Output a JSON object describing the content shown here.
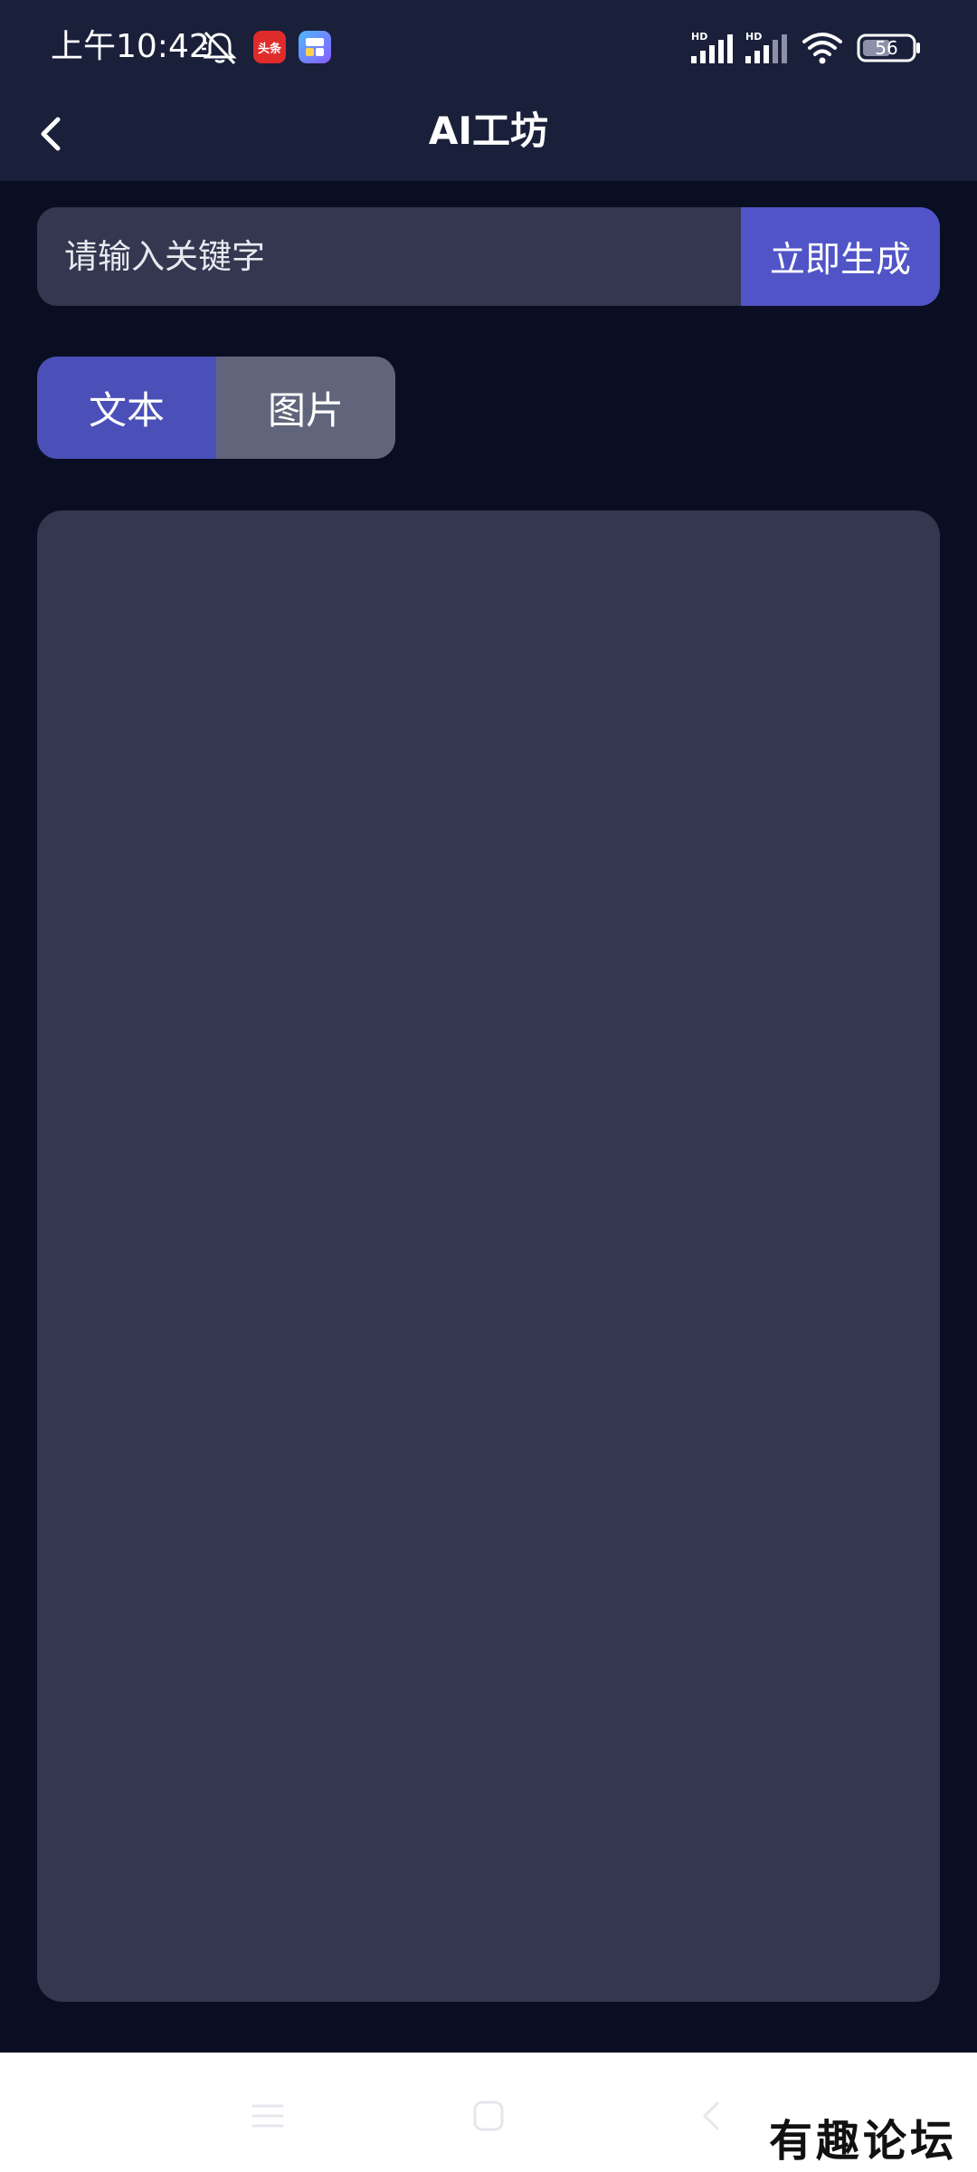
{
  "status_bar": {
    "time": "上午10:42",
    "badge_toutiao": "头条",
    "battery": "56",
    "signal1_label": "HD",
    "signal2_label": "HD"
  },
  "header": {
    "title": "AI工坊"
  },
  "search": {
    "placeholder": "请输入关键字",
    "value": "",
    "generate_label": "立即生成"
  },
  "tabs": [
    {
      "label": "文本",
      "active": true
    },
    {
      "label": "图片",
      "active": false
    }
  ],
  "watermark": "有趣论坛",
  "colors": {
    "background": "#0a0e22",
    "topbar": "#1a1f3a",
    "card": "#33374f",
    "accent": "#5054c6",
    "tab_inactive": "#60657c"
  }
}
